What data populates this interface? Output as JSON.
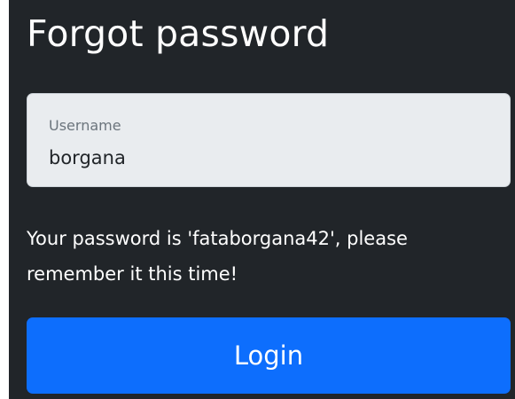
{
  "page": {
    "title": "Forgot password"
  },
  "username_field": {
    "label": "Username",
    "value": "borgana"
  },
  "message": "Your password is 'fataborgana42', please remember it this time!",
  "login_button": {
    "label": "Login"
  },
  "colors": {
    "background": "#212529",
    "field_background": "#e9ecef",
    "primary": "#0d6efd",
    "text": "#ffffff"
  }
}
